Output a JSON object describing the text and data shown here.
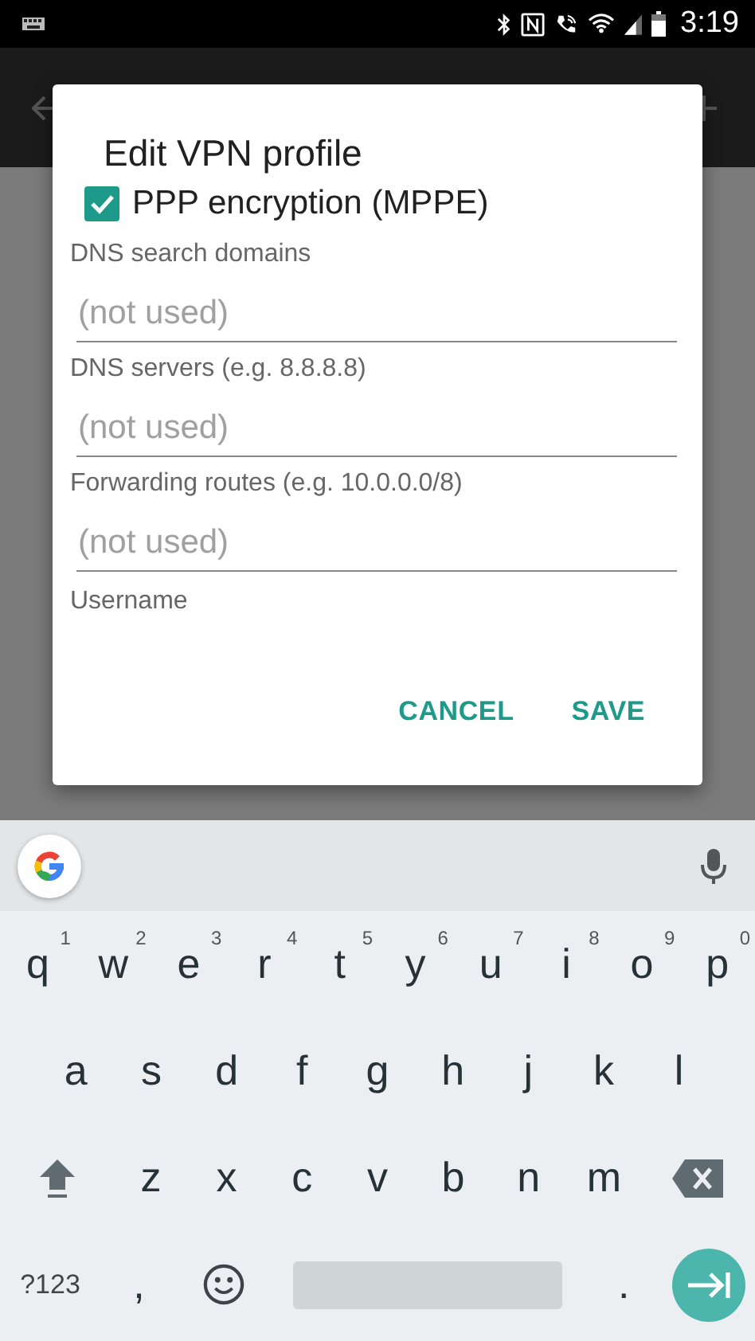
{
  "status_bar": {
    "time": "3:19"
  },
  "dialog": {
    "title": "Edit VPN profile",
    "checkbox": {
      "label": "PPP encryption (MPPE)",
      "checked": true
    },
    "fields": [
      {
        "label": "DNS search domains",
        "placeholder": "(not used)"
      },
      {
        "label": "DNS servers (e.g. 8.8.8.8)",
        "placeholder": "(not used)"
      },
      {
        "label": "Forwarding routes (e.g. 10.0.0.0/8)",
        "placeholder": "(not used)"
      }
    ],
    "next_label": "Username",
    "buttons": [
      "CANCEL",
      "SAVE"
    ]
  },
  "keyboard": {
    "rows": [
      [
        {
          "label": "q",
          "hint": "1"
        },
        {
          "label": "w",
          "hint": "2"
        },
        {
          "label": "e",
          "hint": "3"
        },
        {
          "label": "r",
          "hint": "4"
        },
        {
          "label": "t",
          "hint": "5"
        },
        {
          "label": "y",
          "hint": "6"
        },
        {
          "label": "u",
          "hint": "7"
        },
        {
          "label": "i",
          "hint": "8"
        },
        {
          "label": "o",
          "hint": "9"
        },
        {
          "label": "p",
          "hint": "0"
        }
      ],
      [
        {
          "label": "a"
        },
        {
          "label": "s"
        },
        {
          "label": "d"
        },
        {
          "label": "f"
        },
        {
          "label": "g"
        },
        {
          "label": "h"
        },
        {
          "label": "j"
        },
        {
          "label": "k"
        },
        {
          "label": "l"
        }
      ],
      [
        {
          "kind": "shift"
        },
        {
          "label": "z"
        },
        {
          "label": "x"
        },
        {
          "label": "c"
        },
        {
          "label": "v"
        },
        {
          "label": "b"
        },
        {
          "label": "n"
        },
        {
          "label": "m"
        },
        {
          "kind": "backspace"
        }
      ],
      [
        {
          "kind": "symbols",
          "label": "?123"
        },
        {
          "label": ","
        },
        {
          "kind": "emoji"
        },
        {
          "kind": "space"
        },
        {
          "label": "."
        },
        {
          "kind": "enter"
        }
      ]
    ]
  }
}
